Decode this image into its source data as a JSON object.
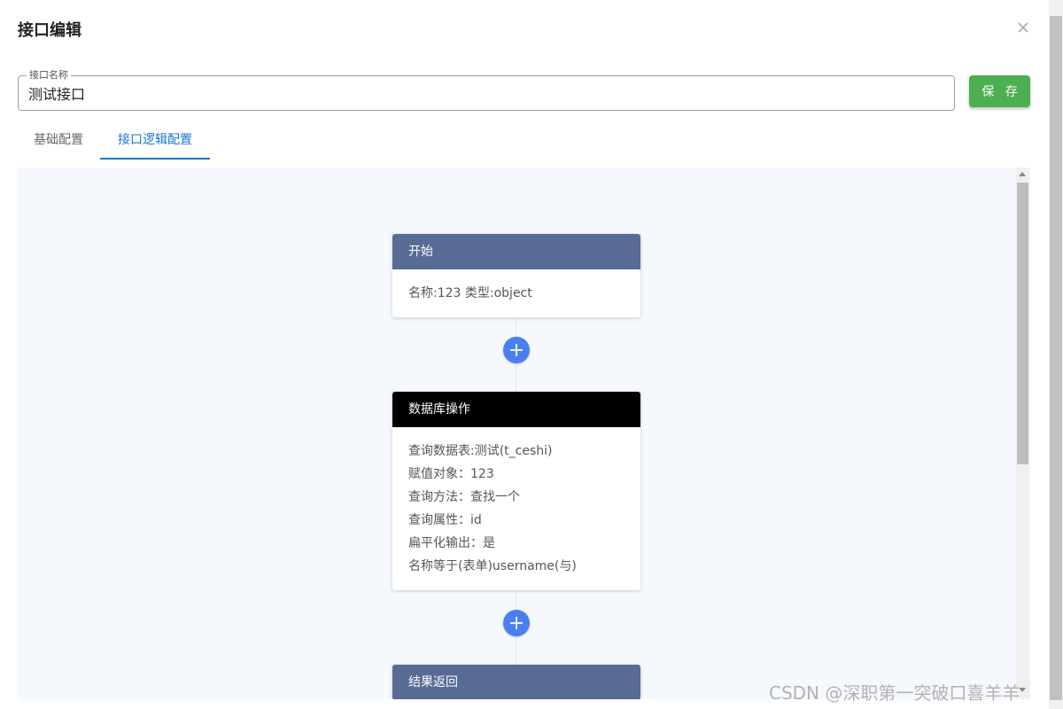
{
  "dialog": {
    "title": "接口编辑"
  },
  "form": {
    "name_label": "接口名称",
    "name_value": "测试接口",
    "save_label": "保 存"
  },
  "tabs": [
    {
      "label": "基础配置",
      "active": false
    },
    {
      "label": "接口逻辑配置",
      "active": true
    }
  ],
  "flow": {
    "nodes": [
      {
        "title": "开始",
        "header_color": "#586b95",
        "lines": [
          "名称:123 类型:object"
        ]
      },
      {
        "title": "数据库操作",
        "header_color": "#000000",
        "lines": [
          "查询数据表:测试(t_ceshi)",
          "赋值对象：123",
          "查询方法：查找一个",
          "查询属性：id",
          "扁平化输出：是",
          "名称等于(表单)username(与)"
        ]
      },
      {
        "title": "结果返回",
        "header_color": "#586b95",
        "lines": []
      }
    ],
    "add_icon": "plus-icon",
    "add_color": "#4a7ff0"
  },
  "icons": {
    "close": "close-icon"
  },
  "colors": {
    "accent": "#1976d2",
    "save": "#4caf50",
    "canvas_bg": "#f5f8fd"
  },
  "watermark": "CSDN @深职第一突破口喜羊羊"
}
